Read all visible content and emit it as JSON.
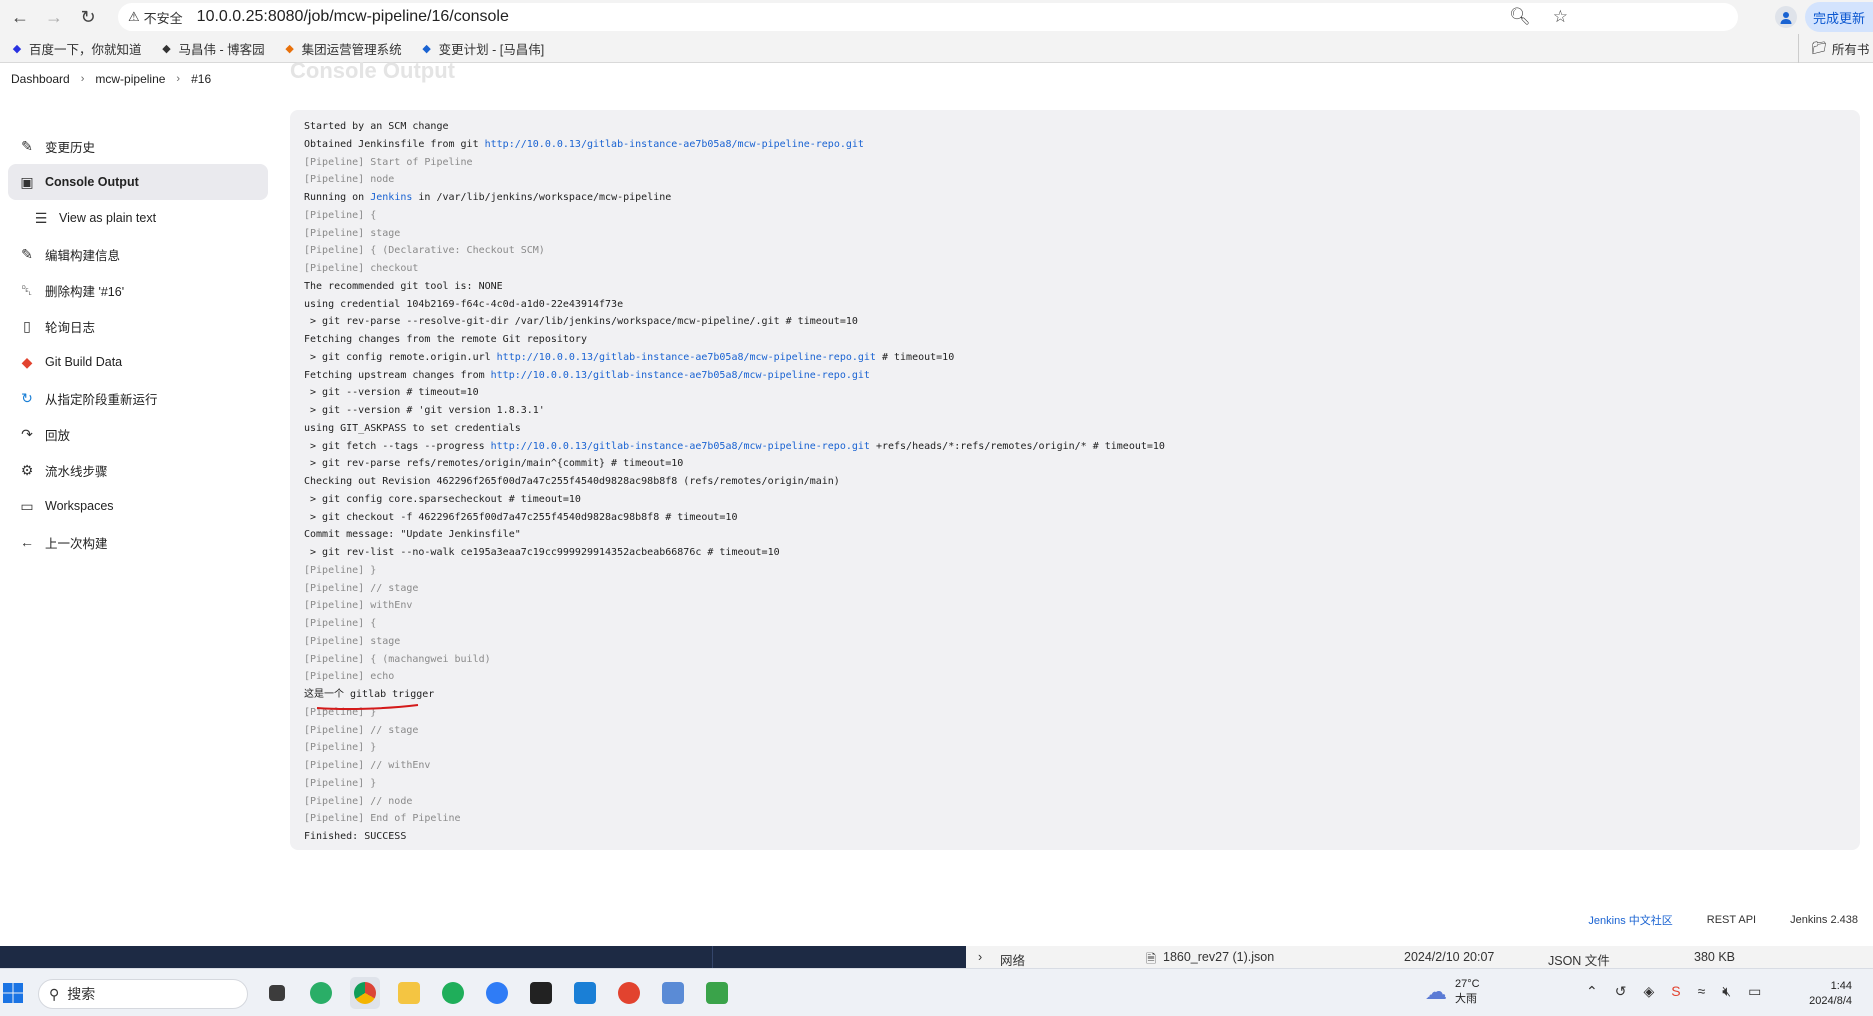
{
  "browser": {
    "insecure_label": "不安全",
    "url": "10.0.0.25:8080/job/mcw-pipeline/16/console",
    "update_label": "完成更新"
  },
  "bookmarks": [
    {
      "label": "百度一下，你就知道",
      "color": "#2932e1"
    },
    {
      "label": "马昌伟 - 博客园",
      "color": "#333333"
    },
    {
      "label": "集团运营管理系统",
      "color": "#e8700a"
    },
    {
      "label": "变更计划 - [马昌伟]",
      "color": "#1a63d2"
    }
  ],
  "bookmarks_right": "所有书",
  "breadcrumb": [
    "Dashboard",
    "mcw-pipeline",
    "#16"
  ],
  "ghost_title": "Console Output",
  "sidebar": [
    {
      "label": "变更历史",
      "icon": "notepad-icon"
    },
    {
      "label": "Console Output",
      "icon": "terminal-icon",
      "active": true
    },
    {
      "label": "View as plain text",
      "icon": "document-icon",
      "sub": true
    },
    {
      "label": "编辑构建信息",
      "icon": "notepad-icon"
    },
    {
      "label": "删除构建 '#16'",
      "icon": "trash-icon"
    },
    {
      "label": "轮询日志",
      "icon": "clipboard-icon"
    },
    {
      "label": "Git Build Data",
      "icon": "git-icon"
    },
    {
      "label": "从指定阶段重新运行",
      "icon": "rerun-icon"
    },
    {
      "label": "回放",
      "icon": "replay-icon"
    },
    {
      "label": "流水线步骤",
      "icon": "gear-icon"
    },
    {
      "label": "Workspaces",
      "icon": "folder-icon"
    },
    {
      "label": "上一次构建",
      "icon": "arrow-left-icon"
    }
  ],
  "console": [
    {
      "text": "Started by an SCM change"
    },
    {
      "text": "Obtained Jenkinsfile from git ",
      "link": "http://10.0.0.13/gitlab-instance-ae7b05a8/mcw-pipeline-repo.git"
    },
    {
      "text": "[Pipeline] Start of Pipeline",
      "pipe": true
    },
    {
      "text": "[Pipeline] node",
      "pipe": true
    },
    {
      "text": "Running on ",
      "link": "Jenkins",
      "after": " in /var/lib/jenkins/workspace/mcw-pipeline"
    },
    {
      "text": "[Pipeline] {",
      "pipe": true
    },
    {
      "text": "[Pipeline] stage",
      "pipe": true
    },
    {
      "text": "[Pipeline] { (Declarative: Checkout SCM)",
      "pipe": true
    },
    {
      "text": "[Pipeline] checkout",
      "pipe": true
    },
    {
      "text": "The recommended git tool is: NONE"
    },
    {
      "text": "using credential 104b2169-f64c-4c0d-a1d0-22e43914f73e"
    },
    {
      "text": " > git rev-parse --resolve-git-dir /var/lib/jenkins/workspace/mcw-pipeline/.git # timeout=10"
    },
    {
      "text": "Fetching changes from the remote Git repository"
    },
    {
      "text": " > git config remote.origin.url ",
      "link": "http://10.0.0.13/gitlab-instance-ae7b05a8/mcw-pipeline-repo.git",
      "after": " # timeout=10"
    },
    {
      "text": "Fetching upstream changes from ",
      "link": "http://10.0.0.13/gitlab-instance-ae7b05a8/mcw-pipeline-repo.git"
    },
    {
      "text": " > git --version # timeout=10"
    },
    {
      "text": " > git --version # 'git version 1.8.3.1'"
    },
    {
      "text": "using GIT_ASKPASS to set credentials"
    },
    {
      "text": " > git fetch --tags --progress ",
      "link": "http://10.0.0.13/gitlab-instance-ae7b05a8/mcw-pipeline-repo.git",
      "after": " +refs/heads/*:refs/remotes/origin/* # timeout=10"
    },
    {
      "text": " > git rev-parse refs/remotes/origin/main^{commit} # timeout=10"
    },
    {
      "text": "Checking out Revision 462296f265f00d7a47c255f4540d9828ac98b8f8 (refs/remotes/origin/main)"
    },
    {
      "text": " > git config core.sparsecheckout # timeout=10"
    },
    {
      "text": " > git checkout -f 462296f265f00d7a47c255f4540d9828ac98b8f8 # timeout=10"
    },
    {
      "text": "Commit message: \"Update Jenkinsfile\""
    },
    {
      "text": " > git rev-list --no-walk ce195a3eaa7c19cc999929914352acbeab66876c # timeout=10"
    },
    {
      "text": "[Pipeline] }",
      "pipe": true
    },
    {
      "text": "[Pipeline] // stage",
      "pipe": true
    },
    {
      "text": "[Pipeline] withEnv",
      "pipe": true
    },
    {
      "text": "[Pipeline] {",
      "pipe": true
    },
    {
      "text": "[Pipeline] stage",
      "pipe": true
    },
    {
      "text": "[Pipeline] { (machangwei build)",
      "pipe": true
    },
    {
      "text": "[Pipeline] echo",
      "pipe": true
    },
    {
      "text": "这是一个 gitlab trigger"
    },
    {
      "text": "[Pipeline] }",
      "pipe": true
    },
    {
      "text": "[Pipeline] // stage",
      "pipe": true
    },
    {
      "text": "[Pipeline] }",
      "pipe": true
    },
    {
      "text": "[Pipeline] // withEnv",
      "pipe": true
    },
    {
      "text": "[Pipeline] }",
      "pipe": true
    },
    {
      "text": "[Pipeline] // node",
      "pipe": true
    },
    {
      "text": "[Pipeline] End of Pipeline",
      "pipe": true
    },
    {
      "text": "Finished: SUCCESS"
    }
  ],
  "footer": {
    "community": "Jenkins 中文社区",
    "rest_api": "REST API",
    "version": "Jenkins 2.438"
  },
  "explorer_row": {
    "tree_label": "网络",
    "file_name": "1860_rev27 (1).json",
    "modified": "2024/2/10 20:07",
    "file_type": "JSON 文件",
    "size": "380 KB"
  },
  "taskbar": {
    "search_placeholder": "搜索",
    "weather_temp": "27°C",
    "weather_desc": "大雨",
    "time": "1:44",
    "date": "2024/8/4"
  }
}
